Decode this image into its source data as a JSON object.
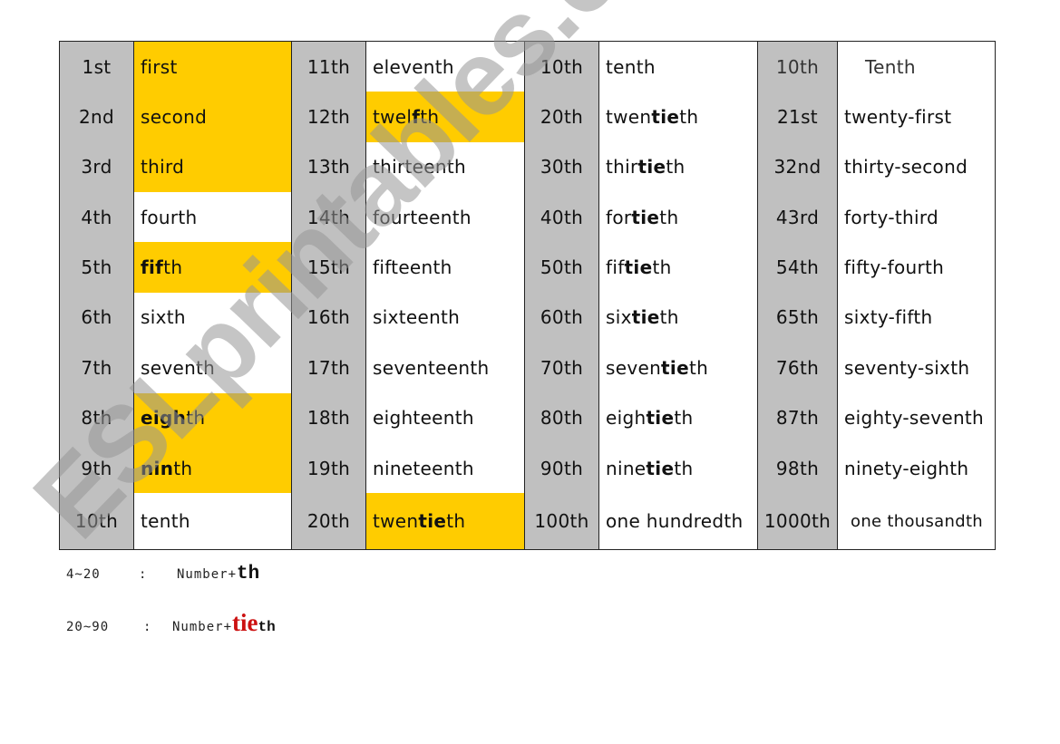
{
  "colors": {
    "number_column": "#C0C0C0",
    "highlight": "#FFCC00",
    "tie_red": "#CC1111"
  },
  "blocks": [
    {
      "rows": [
        {
          "num": "1st",
          "parts": [
            {
              "t": "first",
              "b": false
            }
          ],
          "highlight": true
        },
        {
          "num": "2nd",
          "parts": [
            {
              "t": "second",
              "b": false
            }
          ],
          "highlight": true
        },
        {
          "num": "3rd",
          "parts": [
            {
              "t": "third",
              "b": false
            }
          ],
          "highlight": true
        },
        {
          "num": "4th",
          "parts": [
            {
              "t": "fourth",
              "b": false
            }
          ],
          "highlight": false
        },
        {
          "num": "5th",
          "parts": [
            {
              "t": "fif",
              "b": true
            },
            {
              "t": "th",
              "b": false
            }
          ],
          "highlight": true
        },
        {
          "num": "6th",
          "parts": [
            {
              "t": "sixth",
              "b": false
            }
          ],
          "highlight": false
        },
        {
          "num": "7th",
          "parts": [
            {
              "t": "seventh",
              "b": false
            }
          ],
          "highlight": false
        },
        {
          "num": "8th",
          "parts": [
            {
              "t": "eigh",
              "b": true
            },
            {
              "t": "th",
              "b": false
            }
          ],
          "highlight": true
        },
        {
          "num": "9th",
          "parts": [
            {
              "t": "nin",
              "b": true
            },
            {
              "t": "th",
              "b": false
            }
          ],
          "highlight": true
        },
        {
          "num": "10th",
          "parts": [
            {
              "t": "tenth",
              "b": false
            }
          ],
          "highlight": false
        }
      ]
    },
    {
      "rows": [
        {
          "num": "11th",
          "parts": [
            {
              "t": "eleventh",
              "b": false
            }
          ],
          "highlight": false
        },
        {
          "num": "12th",
          "parts": [
            {
              "t": "twel",
              "b": false
            },
            {
              "t": "f",
              "b": true
            },
            {
              "t": "th",
              "b": false
            }
          ],
          "highlight": true
        },
        {
          "num": "13th",
          "parts": [
            {
              "t": "thirteenth",
              "b": false
            }
          ],
          "highlight": false
        },
        {
          "num": "14th",
          "parts": [
            {
              "t": "fourteenth",
              "b": false
            }
          ],
          "highlight": false
        },
        {
          "num": "15th",
          "parts": [
            {
              "t": "fifteenth",
              "b": false
            }
          ],
          "highlight": false
        },
        {
          "num": "16th",
          "parts": [
            {
              "t": "sixteenth",
              "b": false
            }
          ],
          "highlight": false
        },
        {
          "num": "17th",
          "parts": [
            {
              "t": "seventeenth",
              "b": false
            }
          ],
          "highlight": false
        },
        {
          "num": "18th",
          "parts": [
            {
              "t": "eighteenth",
              "b": false
            }
          ],
          "highlight": false
        },
        {
          "num": "19th",
          "parts": [
            {
              "t": "nineteenth",
              "b": false
            }
          ],
          "highlight": false
        },
        {
          "num": "20th",
          "parts": [
            {
              "t": "twen",
              "b": false
            },
            {
              "t": "tie",
              "b": true
            },
            {
              "t": "th",
              "b": false
            }
          ],
          "highlight": true
        }
      ]
    },
    {
      "rows": [
        {
          "num": "10th",
          "parts": [
            {
              "t": "tenth",
              "b": false
            }
          ],
          "highlight": false
        },
        {
          "num": "20th",
          "parts": [
            {
              "t": "twen",
              "b": false
            },
            {
              "t": "tie",
              "b": true
            },
            {
              "t": "th",
              "b": false
            }
          ],
          "highlight": false
        },
        {
          "num": "30th",
          "parts": [
            {
              "t": "thir",
              "b": false
            },
            {
              "t": "tie",
              "b": true
            },
            {
              "t": "th",
              "b": false
            }
          ],
          "highlight": false
        },
        {
          "num": "40th",
          "parts": [
            {
              "t": "for",
              "b": false
            },
            {
              "t": "tie",
              "b": true
            },
            {
              "t": "th",
              "b": false
            }
          ],
          "highlight": false
        },
        {
          "num": "50th",
          "parts": [
            {
              "t": "fif",
              "b": false
            },
            {
              "t": "tie",
              "b": true
            },
            {
              "t": "th",
              "b": false
            }
          ],
          "highlight": false
        },
        {
          "num": "60th",
          "parts": [
            {
              "t": "six",
              "b": false
            },
            {
              "t": "tie",
              "b": true
            },
            {
              "t": "th",
              "b": false
            }
          ],
          "highlight": false
        },
        {
          "num": "70th",
          "parts": [
            {
              "t": "seven",
              "b": false
            },
            {
              "t": "tie",
              "b": true
            },
            {
              "t": "th",
              "b": false
            }
          ],
          "highlight": false
        },
        {
          "num": "80th",
          "parts": [
            {
              "t": "eigh",
              "b": false
            },
            {
              "t": "tie",
              "b": true
            },
            {
              "t": "th",
              "b": false
            }
          ],
          "highlight": false
        },
        {
          "num": "90th",
          "parts": [
            {
              "t": "nine",
              "b": false
            },
            {
              "t": "tie",
              "b": true
            },
            {
              "t": "th",
              "b": false
            }
          ],
          "highlight": false
        },
        {
          "num": "100th",
          "parts": [
            {
              "t": "one hundredth",
              "b": false
            }
          ],
          "highlight": false
        }
      ]
    },
    {
      "rows": [
        {
          "num": "10th",
          "parts": [
            {
              "t": "Tenth",
              "b": false
            }
          ],
          "highlight": false,
          "muted": true,
          "indent": true
        },
        {
          "num": "21st",
          "parts": [
            {
              "t": "twenty-first",
              "b": false
            }
          ],
          "highlight": false
        },
        {
          "num": "32nd",
          "parts": [
            {
              "t": "thirty-second",
              "b": false
            }
          ],
          "highlight": false
        },
        {
          "num": "43rd",
          "parts": [
            {
              "t": "forty-third",
              "b": false
            }
          ],
          "highlight": false
        },
        {
          "num": "54th",
          "parts": [
            {
              "t": "fifty-fourth",
              "b": false
            }
          ],
          "highlight": false
        },
        {
          "num": "65th",
          "parts": [
            {
              "t": "sixty-fifth",
              "b": false
            }
          ],
          "highlight": false
        },
        {
          "num": "76th",
          "parts": [
            {
              "t": "seventy-sixth",
              "b": false
            }
          ],
          "highlight": false
        },
        {
          "num": "87th",
          "parts": [
            {
              "t": "eighty-seventh",
              "b": false
            }
          ],
          "highlight": false
        },
        {
          "num": "98th",
          "parts": [
            {
              "t": "ninety-eighth",
              "b": false
            }
          ],
          "highlight": false
        },
        {
          "num": "1000th",
          "parts": [
            {
              "t": "one thousandth",
              "b": false
            }
          ],
          "highlight": false,
          "small": true
        }
      ]
    }
  ],
  "notes": [
    {
      "range": "4~20",
      "colon": ":",
      "prefix": "Number+",
      "tie": "",
      "suffix": "th"
    },
    {
      "range": "20~90",
      "colon": ":",
      "prefix": "Number+",
      "tie": "tie",
      "suffix": "th"
    }
  ],
  "watermark": "ESLprintables.com"
}
